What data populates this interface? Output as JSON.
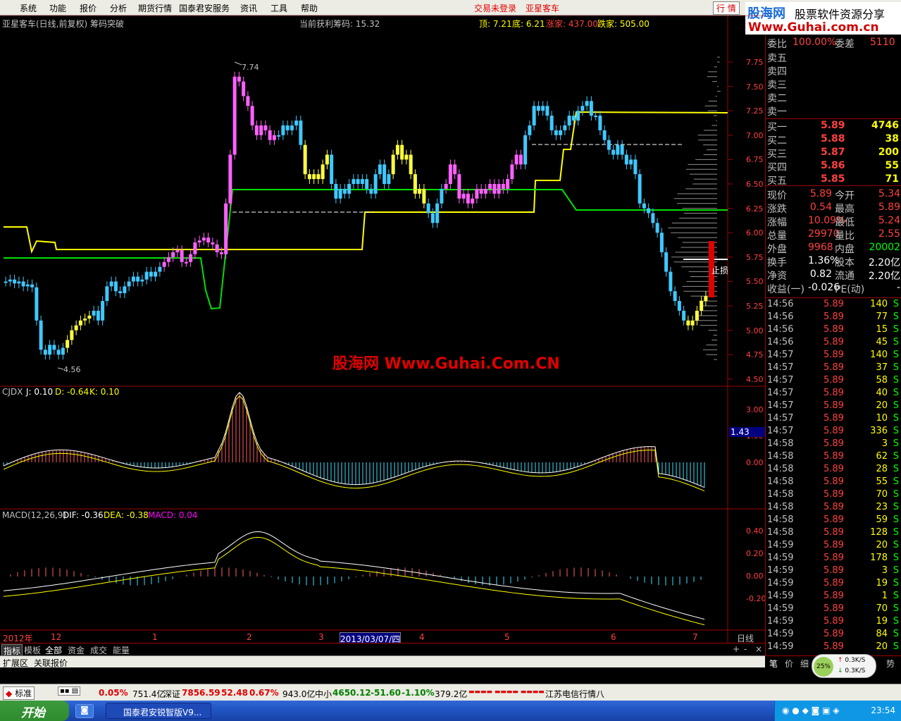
{
  "menu": {
    "items": [
      "系统",
      "功能",
      "报价",
      "分析",
      "期货行情",
      "国泰君安服务",
      "资讯",
      "工具",
      "帮助"
    ],
    "login": "交易未登录",
    "user": "亚星客车",
    "mode": "行 情"
  },
  "logo": {
    "name": "股海网",
    "slogan": "股票软件资源分享",
    "url": "Www.Guhai.com.cn"
  },
  "main": {
    "title": "亚星客车(日线,前复权) 筹码突破",
    "profit": "当前获利筹码: 15.32",
    "top_label": "顶: 7.21",
    "bottom_label": "底: 6.21",
    "up_label": "涨家: 437.00",
    "down_label": "跌家: 505.00",
    "watermark": "股海网 Www.Guhai.Com.CN",
    "high_mark": "7.74",
    "low_mark": "4.56",
    "stop_label": "止损",
    "yticks": [
      "7.75",
      "7.50",
      "7.25",
      "7.00",
      "6.75",
      "6.50",
      "6.25",
      "6.00",
      "5.75",
      "5.50",
      "5.25",
      "5.00",
      "4.75",
      "4.50"
    ]
  },
  "cjdx": {
    "title": "CJDX",
    "j": "J: 0.10",
    "d": "D: -0.64",
    "k": "K: 0.10",
    "yticks": [
      "3.00",
      "1.50",
      "0.00"
    ],
    "current": "1.43"
  },
  "macd": {
    "title": "MACD(12,26,9)",
    "dif": "DIF: -0.36",
    "dea": "DEA: -0.38",
    "macd": "MACD: 0.04",
    "yticks": [
      "0.40",
      "0.20",
      "0.00",
      "-0.20"
    ]
  },
  "xaxis": {
    "labels": [
      "2012年",
      "12",
      "1",
      "2",
      "3",
      "2013/03/07/四",
      "4",
      "5",
      "6",
      "7"
    ],
    "period": "日线"
  },
  "tabs": [
    "指标",
    "模板",
    "全部",
    "资金",
    "成交",
    "能量"
  ],
  "ext_tabs": [
    "扩展区",
    "关联报价"
  ],
  "panel": {
    "header": {
      "label1": "委比",
      "value1": "100.00%",
      "label2": "委差",
      "value2": "5110"
    },
    "sells": [
      "卖五",
      "卖四",
      "卖三",
      "卖二",
      "卖一"
    ],
    "buys": [
      {
        "label": "买一",
        "price": "5.89",
        "vol": "4746"
      },
      {
        "label": "买二",
        "price": "5.88",
        "vol": "38"
      },
      {
        "label": "买三",
        "price": "5.87",
        "vol": "200"
      },
      {
        "label": "买四",
        "price": "5.86",
        "vol": "55"
      },
      {
        "label": "买五",
        "price": "5.85",
        "vol": "71"
      }
    ],
    "stats": [
      {
        "l1": "现价",
        "v1": "5.89",
        "l2": "今开",
        "v2": "5.34"
      },
      {
        "l1": "涨跌",
        "v1": "0.54",
        "l2": "最高",
        "v2": "5.89"
      },
      {
        "l1": "涨幅",
        "v1": "10.09%",
        "l2": "最低",
        "v2": "5.24"
      },
      {
        "l1": "总量",
        "v1": "29970",
        "l2": "量比",
        "v2": "2.55"
      },
      {
        "l1": "外盘",
        "v1": "9968",
        "l2": "内盘",
        "v2": "20002"
      },
      {
        "l1": "换手",
        "v1": "1.36%",
        "l2": "股本",
        "v2": "2.20亿"
      },
      {
        "l1": "净资",
        "v1": "0.82",
        "l2": "流通",
        "v2": "2.20亿"
      },
      {
        "l1": "收益(一)",
        "v1": "-0.026",
        "l2": "PE(动)",
        "v2": "-"
      }
    ],
    "ticks": [
      [
        "14:56",
        "5.89",
        "140"
      ],
      [
        "14:56",
        "5.89",
        "77"
      ],
      [
        "14:56",
        "5.89",
        "15"
      ],
      [
        "14:56",
        "5.89",
        "45"
      ],
      [
        "14:57",
        "5.89",
        "140"
      ],
      [
        "14:57",
        "5.89",
        "37"
      ],
      [
        "14:57",
        "5.89",
        "58"
      ],
      [
        "14:57",
        "5.89",
        "40"
      ],
      [
        "14:57",
        "5.89",
        "20"
      ],
      [
        "14:57",
        "5.89",
        "10"
      ],
      [
        "14:57",
        "5.89",
        "336"
      ],
      [
        "14:58",
        "5.89",
        "3"
      ],
      [
        "14:58",
        "5.89",
        "62"
      ],
      [
        "14:58",
        "5.89",
        "28"
      ],
      [
        "14:58",
        "5.89",
        "55"
      ],
      [
        "14:58",
        "5.89",
        "70"
      ],
      [
        "14:58",
        "5.89",
        "23"
      ],
      [
        "14:58",
        "5.89",
        "59"
      ],
      [
        "14:58",
        "5.89",
        "128"
      ],
      [
        "14:59",
        "5.89",
        "20"
      ],
      [
        "14:59",
        "5.89",
        "178"
      ],
      [
        "14:59",
        "5.89",
        "3"
      ],
      [
        "14:59",
        "5.89",
        "19"
      ],
      [
        "14:59",
        "5.89",
        "1"
      ],
      [
        "14:59",
        "5.89",
        "70"
      ],
      [
        "14:59",
        "5.89",
        "19"
      ],
      [
        "14:59",
        "5.89",
        "84"
      ],
      [
        "14:59",
        "5.89",
        "20"
      ]
    ],
    "tick_flag": "S",
    "bottom_tabs": [
      "笔",
      "价",
      "细",
      "势"
    ]
  },
  "speed": {
    "pct": "25%",
    "up": "0.3K/S",
    "down": "0.3K/S"
  },
  "status": {
    "mode": "标准",
    "v1": "0.05%",
    "v2": "751.4亿",
    "sz_label": "深证",
    "sz_val": "7856.59",
    "sz_chg": "52.48",
    "sz_pct": "0.67%",
    "sz_amt": "943.0亿",
    "zx_label": "中小",
    "zx_val": "4650.12",
    "zx_chg": "-51.60",
    "zx_pct": "-1.10%",
    "zx_amt": "379.2亿",
    "news": "江苏电信行情八"
  },
  "taskbar": {
    "start": "开始",
    "app": "国泰君安锐智版V9...",
    "clock": "23:54"
  }
}
